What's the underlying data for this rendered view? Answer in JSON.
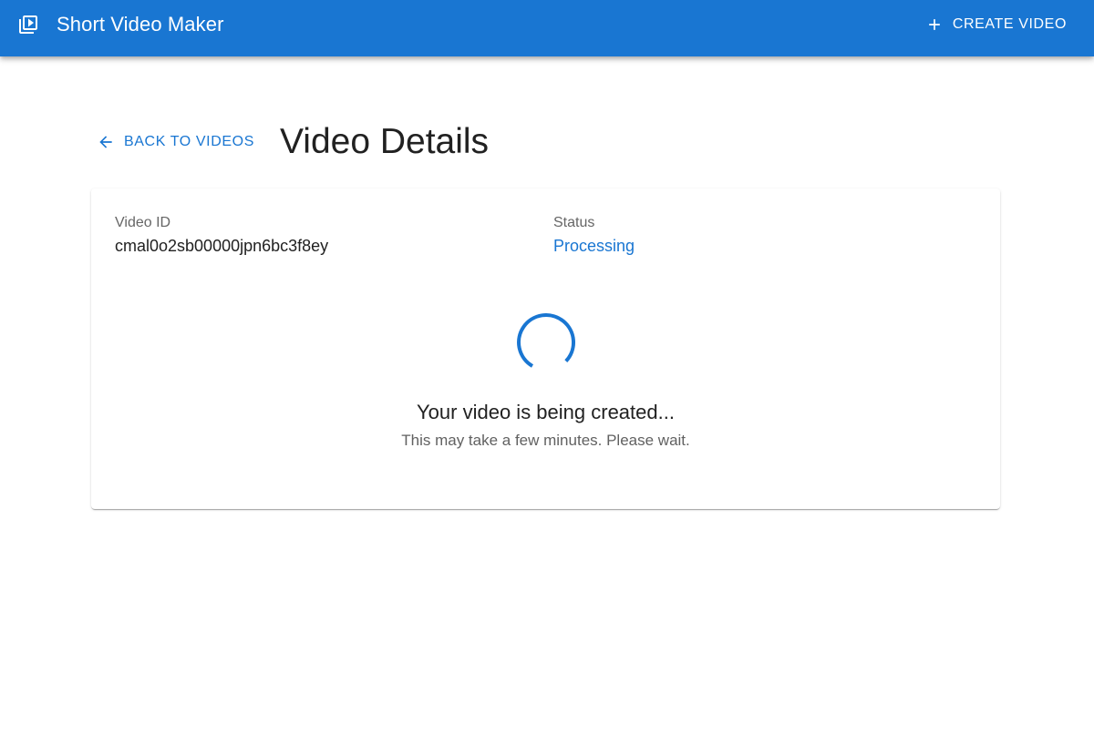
{
  "app": {
    "title": "Short Video Maker",
    "logo_icon": "video-library-icon"
  },
  "toolbar": {
    "create_label": "CREATE VIDEO",
    "create_icon": "plus-icon"
  },
  "page": {
    "back_label": "BACK TO VIDEOS",
    "back_icon": "arrow-left-icon",
    "title": "Video Details"
  },
  "details": {
    "video_id_label": "Video ID",
    "video_id": "cmal0o2sb00000jpn6bc3f8ey",
    "status_label": "Status",
    "status": "Processing"
  },
  "progress": {
    "indicator": "spinner-icon",
    "message": "Your video is being created...",
    "submessage": "This may take a few minutes. Please wait."
  },
  "colors": {
    "primary": "#1976d2",
    "text": "#212121",
    "secondary_text": "#666666"
  }
}
